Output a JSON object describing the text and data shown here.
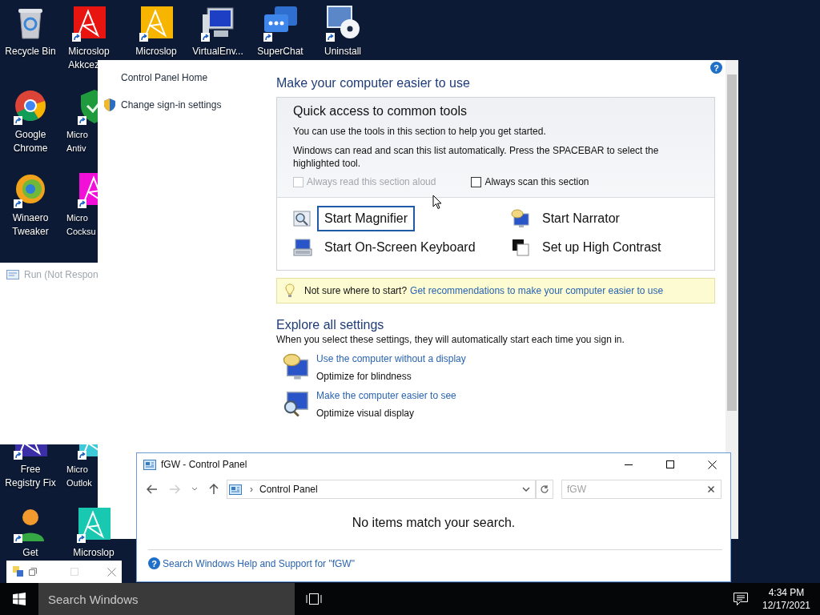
{
  "desktop_icons": [
    {
      "kind": "recycle",
      "lines": [
        "Recycle Bin"
      ],
      "shortcut": false
    },
    {
      "kind": "tile",
      "color": "#e8140f",
      "lines": [
        "Microslop",
        "Akkcez"
      ],
      "shortcut": true
    },
    {
      "kind": "tile",
      "color": "#f7b500",
      "lines": [
        "Microslop"
      ],
      "shortcut": true
    },
    {
      "kind": "monitor",
      "lines": [
        "VirtualEnv..."
      ],
      "shortcut": true
    },
    {
      "kind": "chat",
      "lines": [
        "SuperChat"
      ],
      "shortcut": true
    },
    {
      "kind": "disc",
      "lines": [
        "Uninstall"
      ],
      "shortcut": true
    },
    {
      "kind": "chrome",
      "lines": [
        "Google",
        "Chrome"
      ],
      "shortcut": true
    },
    {
      "kind": "shield",
      "lines": [
        "Micro",
        "Antiv"
      ],
      "shortcut": true
    },
    {
      "kind": "swirl",
      "lines": [
        "Winaero",
        "Tweaker"
      ],
      "shortcut": true
    },
    {
      "kind": "tile",
      "color": "#f20fd8",
      "lines": [
        "Micro",
        "Cocksu"
      ],
      "shortcut": true
    },
    {
      "kind": "tile",
      "color": "#3b2fa8",
      "lines": [
        "Free",
        "Registry Fix"
      ],
      "shortcut": true
    },
    {
      "kind": "tile",
      "color": "#3ec8d8",
      "lines": [
        "Micro",
        "Outlok"
      ],
      "shortcut": true
    },
    {
      "kind": "person",
      "lines": [
        "Get"
      ],
      "shortcut": true
    },
    {
      "kind": "tile",
      "color": "#18c8b0",
      "lines": [
        "Microslop"
      ],
      "shortcut": true
    }
  ],
  "run_window": {
    "title": "Run (Not Respon"
  },
  "control_panel": {
    "help": "?",
    "nav": [
      {
        "label": "Control Panel Home",
        "kind": "plain"
      },
      {
        "label": "Change sign-in settings",
        "kind": "shield"
      }
    ],
    "title": "Make your computer easier to use",
    "quick_access": {
      "title": "Quick access to common tools",
      "intro": "You can use the tools in this section to help you get started.",
      "note": "Windows can read and scan this list automatically.  Press the SPACEBAR to select the highlighted tool.",
      "checkboxes": [
        {
          "label": "Always read this section aloud",
          "checked": false,
          "disabled": true
        },
        {
          "label": "Always scan this section",
          "checked": false,
          "disabled": false
        }
      ],
      "tools": [
        {
          "label": "Start Magnifier",
          "kind": "magnifier",
          "selected": true
        },
        {
          "label": "Start Narrator",
          "kind": "narrator",
          "selected": false
        },
        {
          "label": "Start On-Screen Keyboard",
          "kind": "keyboard",
          "selected": false
        },
        {
          "label": "Set up High Contrast",
          "kind": "contrast",
          "selected": false
        }
      ]
    },
    "tip": {
      "text": "Not sure where to start?",
      "link": "Get recommendations to make your computer easier to use"
    },
    "explore": {
      "title": "Explore all settings",
      "description": "When you select these settings, they will automatically start each time you sign in.",
      "items": [
        {
          "link": "Use the computer without a display",
          "description": "Optimize for blindness",
          "kind": "narrator"
        },
        {
          "link": "Make the computer easier to see",
          "description": "Optimize visual display",
          "kind": "magnifier"
        }
      ]
    }
  },
  "explorer": {
    "title": "fGW - Control Panel",
    "separator": "›",
    "address": "Control Panel",
    "search": {
      "value": "fGW"
    },
    "message": "No items match your search.",
    "help_glyph": "?",
    "help_link": "Search Windows Help and Support for \"fGW\""
  },
  "taskbar": {
    "search": {
      "placeholder": "Search Windows"
    },
    "time": "4:34 PM",
    "date": "12/17/2021"
  }
}
